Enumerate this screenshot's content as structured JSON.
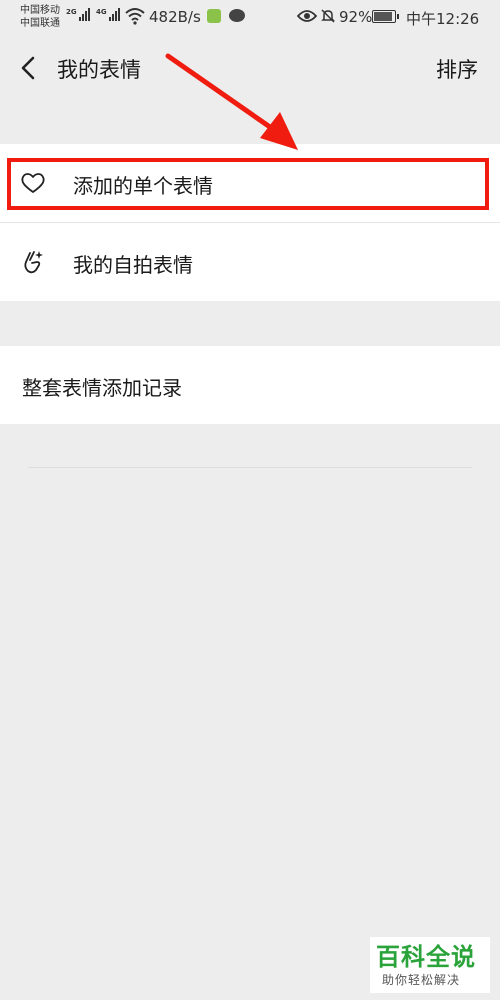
{
  "status_bar": {
    "carrier_1": "中国移动",
    "carrier_2": "中国联通",
    "net_1": "2G",
    "net_2": "4G",
    "speed": "482B/s",
    "battery": "92%",
    "time": "中午12:26",
    "battery_level": 0.92
  },
  "nav": {
    "title": "我的表情",
    "sort": "排序"
  },
  "list1": [
    {
      "label": "添加的单个表情",
      "icon": "heart-outline-icon"
    },
    {
      "label": "我的自拍表情",
      "icon": "finger-heart-icon"
    }
  ],
  "list2": [
    {
      "label": "整套表情添加记录"
    }
  ],
  "watermark": {
    "title": "百科全说",
    "subtitle": "助你轻松解决"
  },
  "colors": {
    "highlight": "#f01c10",
    "background": "#ededed",
    "watermark": "#2aa33a"
  }
}
